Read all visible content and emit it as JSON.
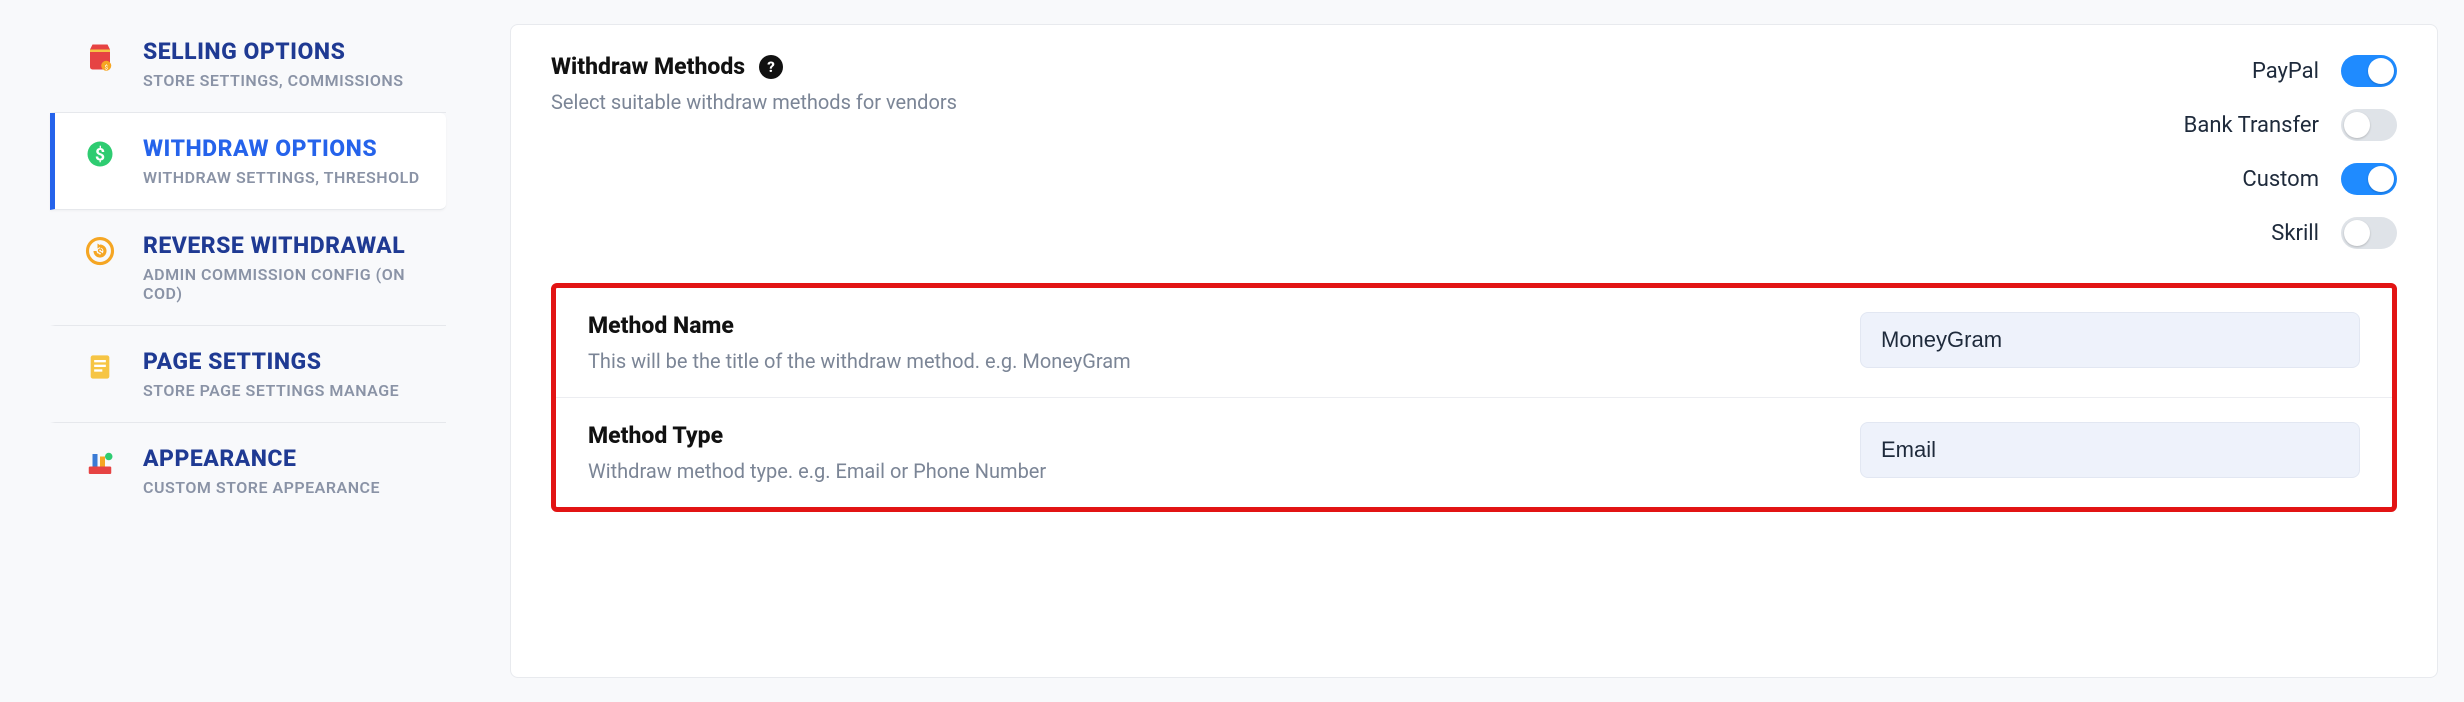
{
  "sidebar": {
    "items": [
      {
        "title": "SELLING OPTIONS",
        "sub": "STORE SETTINGS, COMMISSIONS",
        "active": false,
        "icon": "shopping-bag-icon"
      },
      {
        "title": "WITHDRAW OPTIONS",
        "sub": "WITHDRAW SETTINGS, THRESHOLD",
        "active": true,
        "icon": "dollar-circle-icon"
      },
      {
        "title": "REVERSE WITHDRAWAL",
        "sub": "ADMIN COMMISSION CONFIG (ON COD)",
        "active": false,
        "icon": "refund-circle-icon"
      },
      {
        "title": "PAGE SETTINGS",
        "sub": "STORE PAGE SETTINGS MANAGE",
        "active": false,
        "icon": "document-icon"
      },
      {
        "title": "APPEARANCE",
        "sub": "CUSTOM STORE APPEARANCE",
        "active": false,
        "icon": "paint-icon"
      }
    ]
  },
  "withdraw_methods": {
    "title": "Withdraw Methods",
    "desc": "Select suitable withdraw methods for vendors",
    "help": "?",
    "options": [
      {
        "label": "PayPal",
        "on": true
      },
      {
        "label": "Bank Transfer",
        "on": false
      },
      {
        "label": "Custom",
        "on": true
      },
      {
        "label": "Skrill",
        "on": false
      }
    ]
  },
  "custom_fields": {
    "method_name": {
      "label": "Method Name",
      "desc": "This will be the title of the withdraw method. e.g. MoneyGram",
      "value": "MoneyGram"
    },
    "method_type": {
      "label": "Method Type",
      "desc": "Withdraw method type. e.g. Email or Phone Number",
      "value": "Email"
    }
  }
}
